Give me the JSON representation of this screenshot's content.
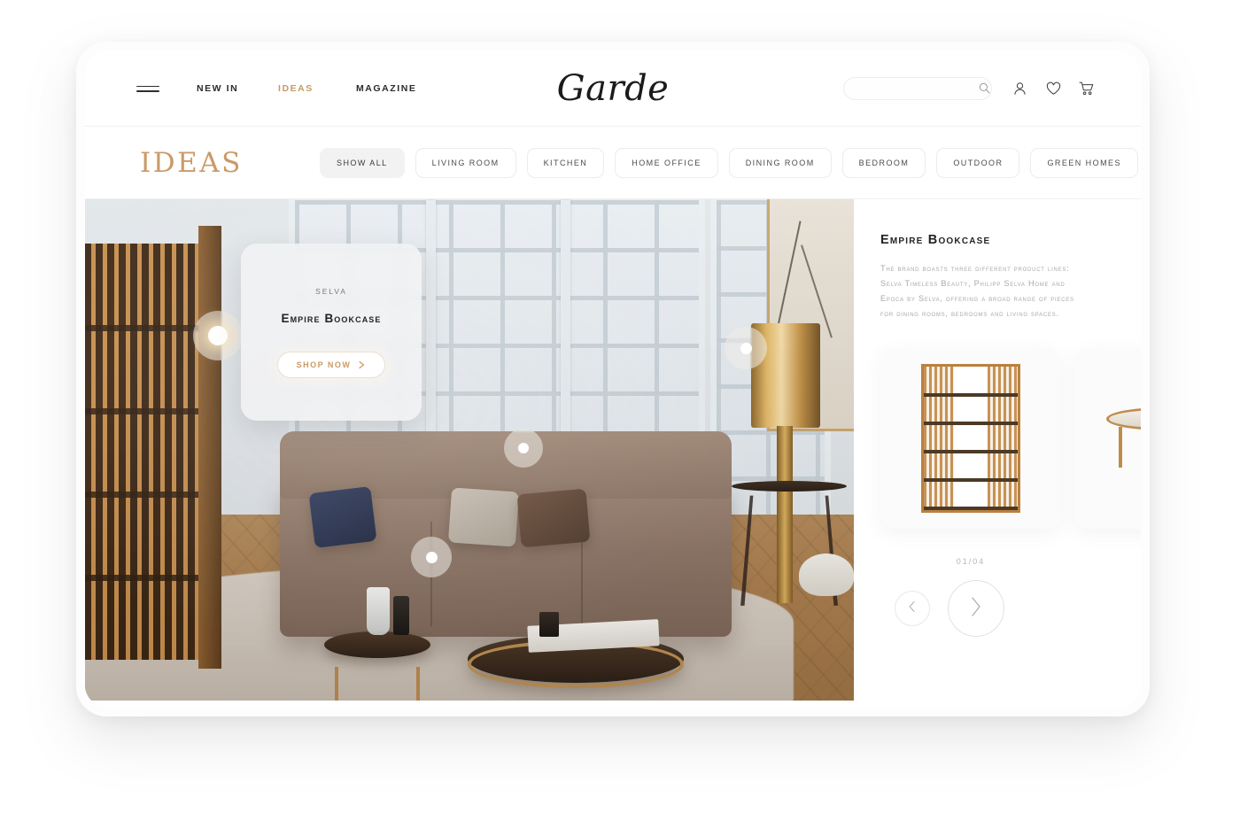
{
  "brand": {
    "logo_text": "Garde"
  },
  "nav": {
    "hamburger_icon": "hamburger-icon",
    "links": [
      {
        "label": "NEW IN",
        "active": false
      },
      {
        "label": "IDEAS",
        "active": true
      },
      {
        "label": "MAGAZINE",
        "active": false
      }
    ],
    "search": {
      "value": "",
      "placeholder": "",
      "icon": "search-icon"
    },
    "icons": [
      {
        "name": "account-icon"
      },
      {
        "name": "wishlist-icon"
      },
      {
        "name": "cart-icon"
      }
    ]
  },
  "filter_bar": {
    "page_title": "IDEAS",
    "pills": [
      {
        "label": "SHOW ALL",
        "active": true
      },
      {
        "label": "LIVING ROOM",
        "active": false
      },
      {
        "label": "KITCHEN",
        "active": false
      },
      {
        "label": "HOME OFFICE",
        "active": false
      },
      {
        "label": "DINING ROOM",
        "active": false
      },
      {
        "label": "BEDROOM",
        "active": false
      },
      {
        "label": "OUTDOOR",
        "active": false
      },
      {
        "label": "GREEN HOMES",
        "active": false
      }
    ]
  },
  "hero": {
    "product_card": {
      "brand": "SELVA",
      "title": "Empire Bookcase",
      "cta_label": "SHOP NOW",
      "cta_arrow_icon": "chevron-right-icon"
    },
    "hotspots": [
      {
        "name": "hotspot-bookcase",
        "active": true
      },
      {
        "name": "hotspot-sofa",
        "active": false
      },
      {
        "name": "hotspot-lamp",
        "active": false
      },
      {
        "name": "hotspot-table",
        "active": false
      }
    ]
  },
  "detail": {
    "title": "Empire Bookcase",
    "description": "The brand boasts three different product lines: Selva Timeless Beauty, Philipp Selva Home and Epoca by Selva, offering a broad range of pieces for dining rooms, bedrooms and living spaces.",
    "carousel": {
      "counter": "01/04",
      "prev_icon": "chevron-left-icon",
      "next_icon": "chevron-right-icon",
      "items": [
        {
          "name": "carousel-item-bookcase"
        },
        {
          "name": "carousel-item-coffee-table"
        }
      ]
    }
  },
  "colors": {
    "accent_gold": "#c79a63",
    "title_gold": "#cb9a68",
    "text_dark": "#232325",
    "text_muted": "#a9a9ad",
    "pill_active_bg": "#f2f2f3"
  }
}
